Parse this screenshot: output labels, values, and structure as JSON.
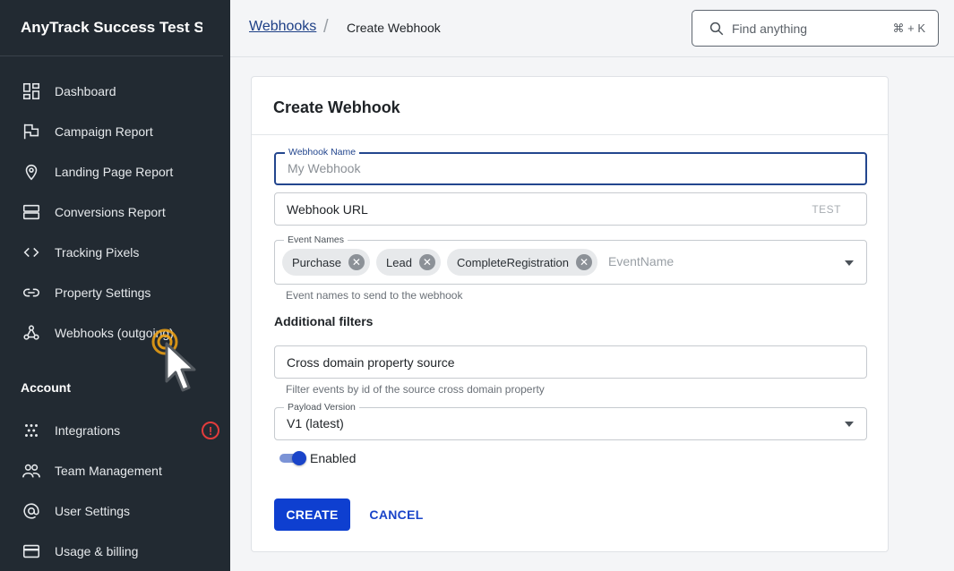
{
  "sidebar": {
    "title": "AnyTrack Success Test Sh...",
    "items": [
      {
        "label": "Dashboard",
        "icon": "dashboard-icon"
      },
      {
        "label": "Campaign Report",
        "icon": "flag-icon"
      },
      {
        "label": "Landing Page Report",
        "icon": "location-pin-icon"
      },
      {
        "label": "Conversions Report",
        "icon": "stack-icon"
      },
      {
        "label": "Tracking Pixels",
        "icon": "code-icon"
      },
      {
        "label": "Property Settings",
        "icon": "link-icon"
      },
      {
        "label": "Webhooks (outgoing)",
        "icon": "webhook-icon"
      }
    ],
    "section_account": "Account",
    "account_items": [
      {
        "label": "Integrations",
        "icon": "integrations-icon",
        "alert": "!"
      },
      {
        "label": "Team Management",
        "icon": "team-icon"
      },
      {
        "label": "User Settings",
        "icon": "at-icon"
      },
      {
        "label": "Usage & billing",
        "icon": "credit-card-icon"
      }
    ]
  },
  "topbar": {
    "breadcrumb_link": "Webhooks",
    "breadcrumb_sep": "/",
    "breadcrumb_current": "Create Webhook",
    "search_placeholder": "Find anything",
    "search_shortcut": "⌘ + K"
  },
  "form": {
    "title": "Create Webhook",
    "name_label": "Webhook Name",
    "name_placeholder": "My Webhook",
    "url_value": "Webhook URL",
    "test_label": "TEST",
    "events_label": "Event Names",
    "events": [
      "Purchase",
      "Lead",
      "CompleteRegistration"
    ],
    "events_placeholder": "EventName",
    "events_helper": "Event names to send to the webhook",
    "filters_heading": "Additional filters",
    "cross_domain_value": "Cross domain property source",
    "cross_domain_helper": "Filter events by id of the source cross domain property",
    "payload_label": "Payload Version",
    "payload_value": "V1 (latest)",
    "enabled_label": "Enabled",
    "enabled": true,
    "create_label": "CREATE",
    "cancel_label": "CANCEL"
  },
  "colors": {
    "sidebar_bg": "#222a32",
    "primary": "#0e3fd0",
    "focus_border": "#23468e",
    "alert": "#e23c3c",
    "cursor_highlight": "#f2a313"
  }
}
